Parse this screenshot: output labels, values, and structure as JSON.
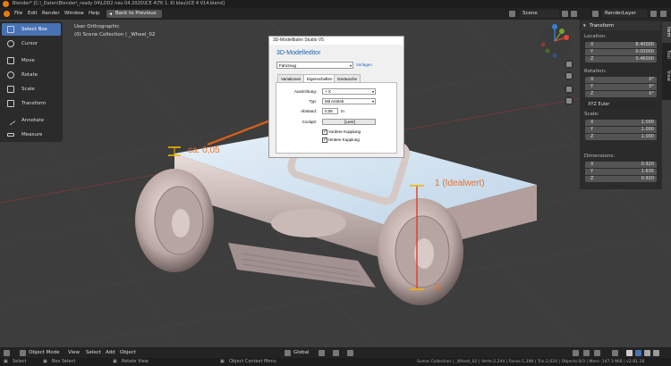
{
  "titlebar": {
    "text": "Blender* [C:\\_Daten\\Blender\\_ready 04\\LOD2 neu 04.2020\\ICE 4\\TK 1. Kl blau\\ICE 4 V14.blend]"
  },
  "menu": {
    "file": "File",
    "edit": "Edit",
    "render": "Render",
    "window": "Window",
    "help": "Help"
  },
  "back_button": "Back to Previous",
  "scene": "Scene",
  "render_layer": "RenderLayer",
  "tools": [
    "Select Box",
    "Cursor",
    "Move",
    "Rotate",
    "Scale",
    "Transform",
    "Annotate",
    "Measure"
  ],
  "viewport": {
    "view_name": "User Orthographic",
    "collection": "(0) Scene Collection | _Wheel_02"
  },
  "annotations": {
    "gap": "ca. 0,05",
    "ideal": "1 (Idealwert)",
    "zero": "0"
  },
  "dialog": {
    "title": "3D-Modellbahn Studio V5",
    "heading": "3D-Modelleditor",
    "category": "Fahrzeug",
    "vorlagen_link": "Vorlagen",
    "tabs": [
      "Variationen",
      "Eigenschaften",
      "Geräusche"
    ],
    "active_tab": "Eigenschaften",
    "fields": {
      "ausrichtung_label": "Ausrichtung:",
      "ausrichtung_value": "+ X",
      "typ_label": "Typ:",
      "typ_value": "Mit Antrieb",
      "abstand_label": "Abstand:",
      "abstand_value": "0,05",
      "abstand_unit": "m",
      "cockpit_label": "Cockpit:",
      "cockpit_button": "[Leer]",
      "vordere": "Vordere Kupplung",
      "hintere": "Hintere Kupplung"
    },
    "vordere_checked": true,
    "hintere_checked": true
  },
  "npanel": {
    "tabs": [
      "Item",
      "Tool",
      "View"
    ],
    "transform_header": "Transform",
    "location_label": "Location:",
    "location": [
      {
        "k": "X",
        "v": "8.40000"
      },
      {
        "k": "Y",
        "v": "0.00000"
      },
      {
        "k": "Z",
        "v": "0.46000"
      }
    ],
    "rotation_label": "Rotation:",
    "rotation": [
      {
        "k": "X",
        "v": "0°"
      },
      {
        "k": "Y",
        "v": "0°"
      },
      {
        "k": "Z",
        "v": "0°"
      }
    ],
    "rotation_mode": "XYZ Euler",
    "scale_label": "Scale:",
    "scale": [
      {
        "k": "X",
        "v": "1.000"
      },
      {
        "k": "Y",
        "v": "1.000"
      },
      {
        "k": "Z",
        "v": "1.000"
      }
    ],
    "dimensions_label": "Dimensions:",
    "dimensions": [
      {
        "k": "X",
        "v": "0.920"
      },
      {
        "k": "Y",
        "v": "1.635"
      },
      {
        "k": "Z",
        "v": "0.920"
      }
    ]
  },
  "bottombar": {
    "mode": "Object Mode",
    "view": "View",
    "select": "Select",
    "add": "Add",
    "object": "Object",
    "orientation": "Global"
  },
  "statusbar": {
    "select": "Select",
    "box_select": "Box Select",
    "rotate_view": "Rotate View",
    "context_menu": "Object Context Menu",
    "stats": "Scene Collection | _Wheel_02 | Verts:2,244 | Faces:1,398 | Tris:2,620 | Objects:0/3 | Mem: 147.3 MiB | v2.81.16"
  },
  "colors": {
    "accent": "#4772b3",
    "annotation": "#e8702a",
    "dialog_heading": "#1a5fb4"
  }
}
